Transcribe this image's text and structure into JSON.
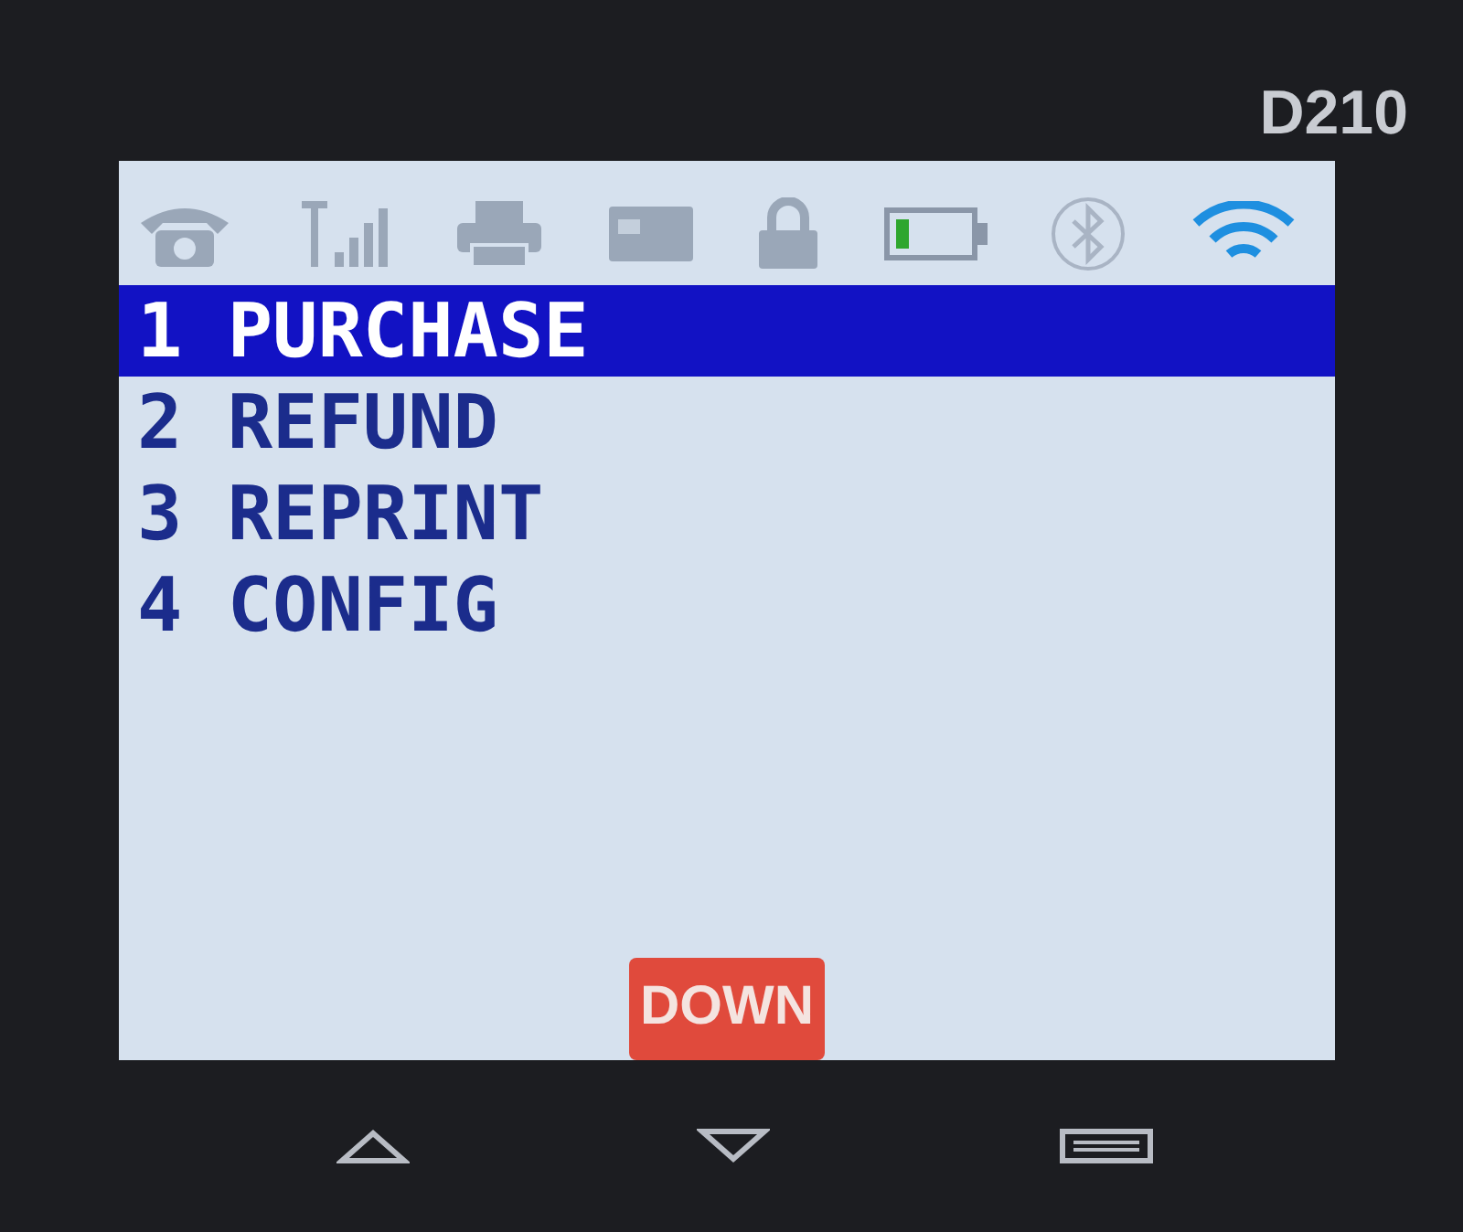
{
  "device": {
    "model": "D210"
  },
  "menu": [
    {
      "number": "1",
      "label": "PURCHASE",
      "selected": true
    },
    {
      "number": "2",
      "label": "REFUND",
      "selected": false
    },
    {
      "number": "3",
      "label": "REPRINT",
      "selected": false
    },
    {
      "number": "4",
      "label": "CONFIG",
      "selected": false
    }
  ],
  "softkey": {
    "label": "DOWN"
  }
}
